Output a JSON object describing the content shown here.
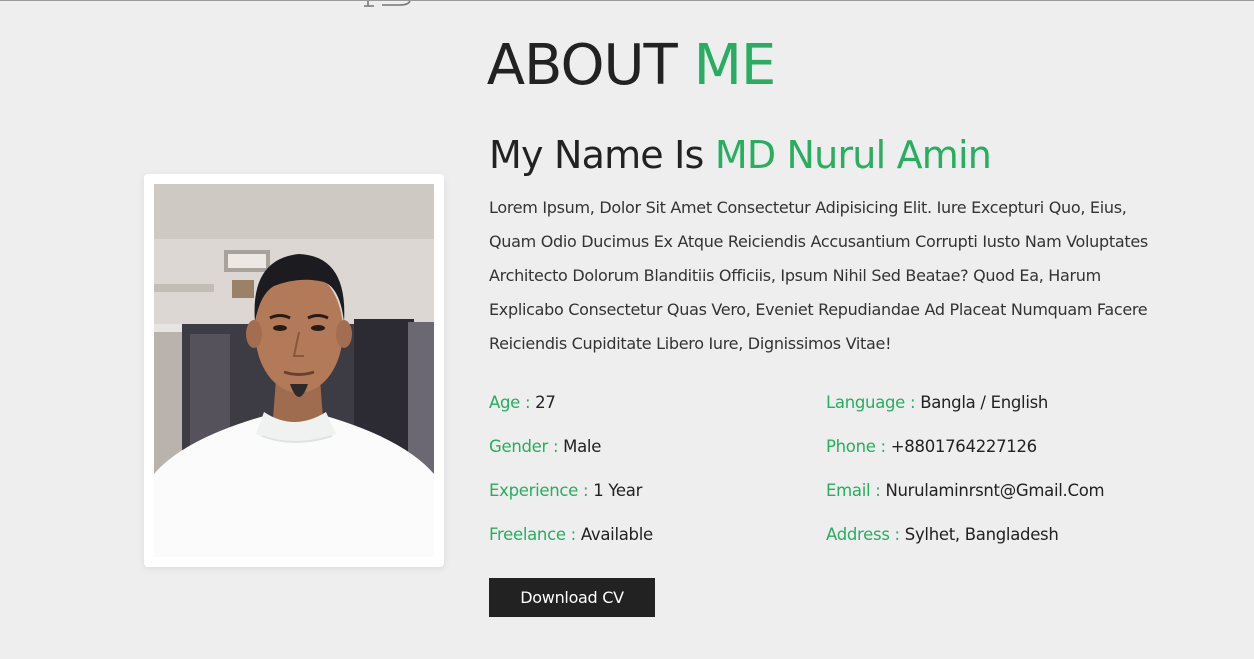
{
  "colors": {
    "accent": "#27ae60",
    "background": "#eeeeee",
    "text": "#222222",
    "button_bg": "#222222",
    "button_text": "#ffffff"
  },
  "section": {
    "title_prefix": "ABOUT",
    "title_accent": "ME"
  },
  "about": {
    "name_prefix": "My Name Is",
    "name": "MD Nurul Amin",
    "bio": "Lorem Ipsum, Dolor Sit Amet Consectetur Adipisicing Elit. Iure Excepturi Quo, Eius, Quam Odio Ducimus Ex Atque Reiciendis Accusantium Corrupti Iusto Nam Voluptates Architecto Dolorum Blanditiis Officiis, Ipsum Nihil Sed Beatae? Quod Ea, Harum Explicabo Consectetur Quas Vero, Eveniet Repudiandae Ad Placeat Numquam Facere Reiciendis Cupiditate Libero Iure, Dignissimos Vitae!",
    "photo_icon": "profile-photo"
  },
  "info": {
    "age": {
      "label": "Age :",
      "value": "27"
    },
    "gender": {
      "label": "Gender :",
      "value": "Male"
    },
    "experience": {
      "label": "Experience :",
      "value": "1 Year"
    },
    "freelance": {
      "label": "Freelance :",
      "value": "Available"
    },
    "language": {
      "label": "Language :",
      "value": "Bangla / English"
    },
    "phone": {
      "label": "Phone :",
      "value": "+8801764227126"
    },
    "email": {
      "label": "Email :",
      "value": "Nurulaminrsnt@Gmail.Com"
    },
    "address": {
      "label": "Address :",
      "value": "Sylhet, Bangladesh"
    }
  },
  "actions": {
    "download_cv": "Download CV"
  }
}
